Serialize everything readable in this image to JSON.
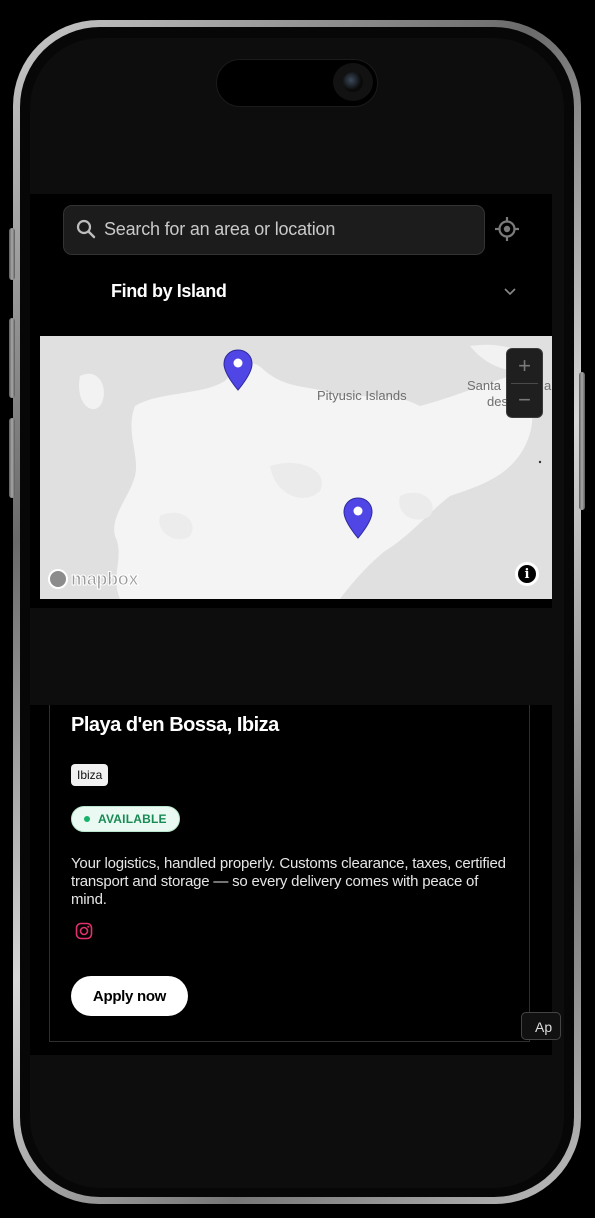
{
  "search": {
    "placeholder": "Search for an area or location"
  },
  "filter": {
    "label": "Find by Island"
  },
  "map": {
    "labels": {
      "islands": "Pityusic Islands",
      "santa_a": "Santa",
      "santa_b": "a",
      "des": "des"
    },
    "zoom_in": "+",
    "zoom_out": "−",
    "attribution": "mapbox",
    "info": "i",
    "pin_color": "#4f46e5"
  },
  "card": {
    "title": "Playa d'en Bossa, Ibiza",
    "tag": "Ibiza",
    "status": "AVAILABLE",
    "description": "Your logistics, handled properly. Customs clearance, taxes, certified transport and storage — so every delivery comes with peace of mind.",
    "apply_label": "Apply now",
    "next_apply_label": "Ap",
    "status_color": "#17b26a",
    "instagram_color": "#e1306c"
  }
}
